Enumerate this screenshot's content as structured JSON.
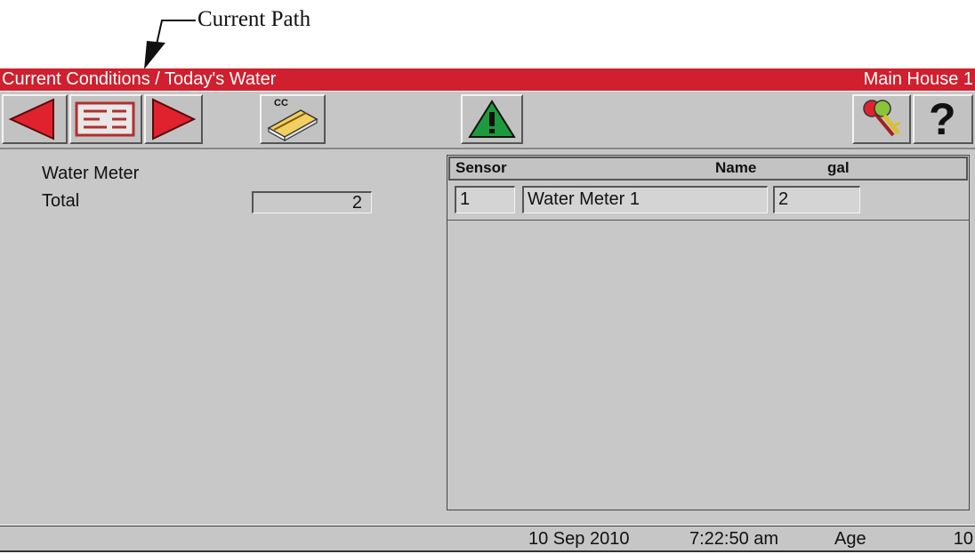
{
  "annotation": {
    "label": "Current Path"
  },
  "titlebar": {
    "path": "Current Conditions / Today's Water",
    "house": "Main House 1"
  },
  "toolbar": {
    "cc_label": "CC",
    "help_label": "?"
  },
  "left_panel": {
    "section_title": "Water Meter",
    "total_label": "Total",
    "total_value": "2"
  },
  "table": {
    "headers": {
      "sensor": "Sensor",
      "name": "Name",
      "unit": "gal"
    },
    "rows": [
      {
        "sensor": "1",
        "name": "Water Meter 1",
        "value": "2"
      }
    ]
  },
  "status": {
    "date": "10 Sep 2010",
    "time": "7:22:50 am",
    "age_label": "Age",
    "age_value": "10"
  },
  "colors": {
    "title_bar": "#d01f2e",
    "arrow_red": "#e0222e",
    "alarm_green": "#1d9a3e",
    "panel_gray": "#c8c8c8"
  },
  "icons": [
    "left-arrow-icon",
    "list-view-icon",
    "right-arrow-icon",
    "house-icon",
    "alarm-warning-icon",
    "keys-icon",
    "help-icon"
  ]
}
